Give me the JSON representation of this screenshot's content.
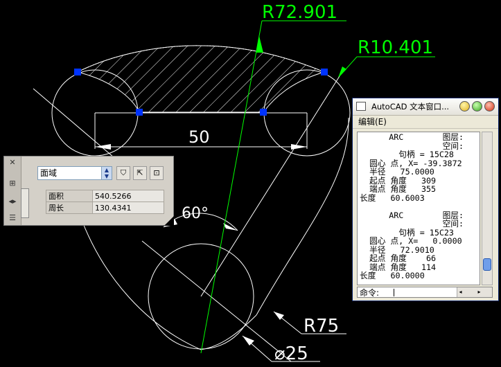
{
  "drawing": {
    "dimensions": {
      "r72": "R72.901",
      "r10": "R10.401",
      "d50": "50",
      "a60": "60°",
      "r75": "R75",
      "dia25": "⌀25"
    }
  },
  "properties_palette": {
    "selected_type": "面域",
    "rows": [
      {
        "label": "面积",
        "value": "540.5266"
      },
      {
        "label": "周长",
        "value": "130.4341"
      }
    ]
  },
  "text_window": {
    "title": "AutoCAD 文本窗口...",
    "menu": "编辑(E)",
    "output_lines": [
      "      ARC        图层:",
      "                 空间:",
      "        句柄 = 15C28",
      "  圆心 点, X= -39.3872",
      "  半径   75.0000",
      "  起点 角度   309",
      "  端点 角度   355",
      "长度   60.6003",
      "",
      "      ARC        图层:",
      "                 空间:",
      "        句柄 = 15C23",
      "  圆心 点, X=   0.0000",
      "  半径   72.9010",
      "  起点 角度    66",
      "  端点 角度   114",
      "长度   60.0000"
    ],
    "prompt": "命令:"
  },
  "colors": {
    "background": "#000000",
    "geometry": "#ffffff",
    "dimension": "#00ff00",
    "grip": "#0033ff"
  }
}
